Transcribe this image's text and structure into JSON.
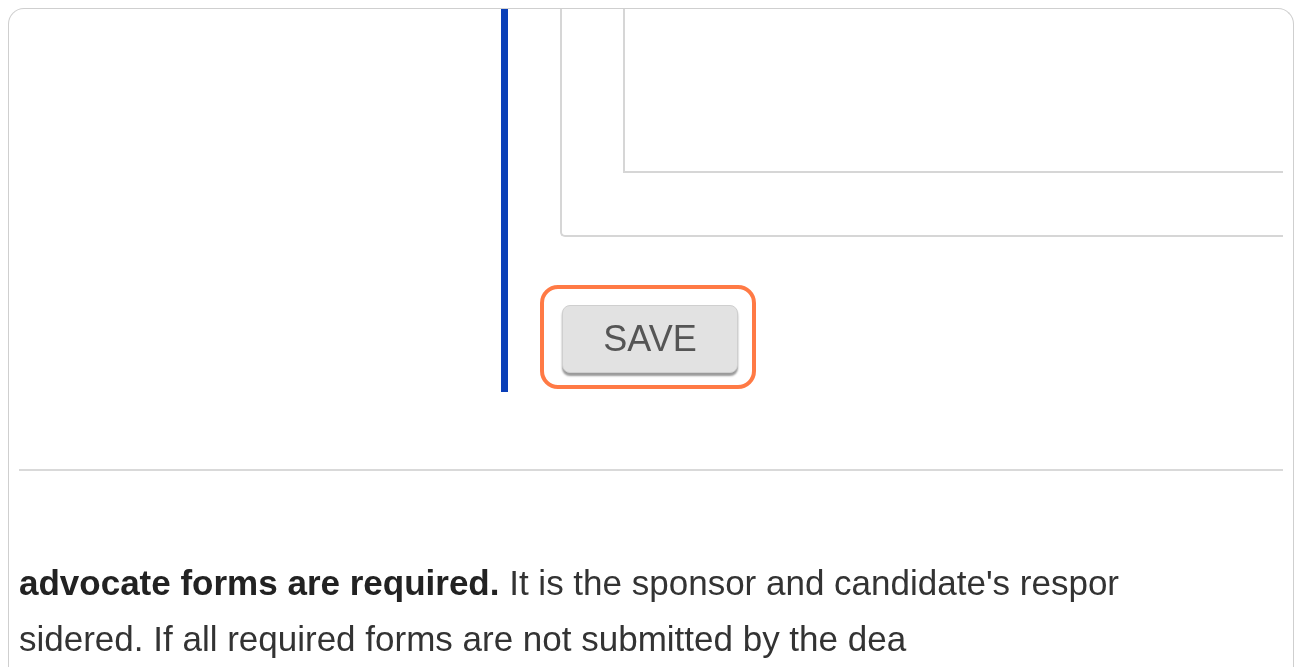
{
  "save_button": {
    "label": "SAVE",
    "highlighted": true
  },
  "paragraph_lines": [
    "**advocate forms are required.** It is the sponsor and candidate's respor",
    "sidered. If all required forms are not submitted by the dea"
  ]
}
